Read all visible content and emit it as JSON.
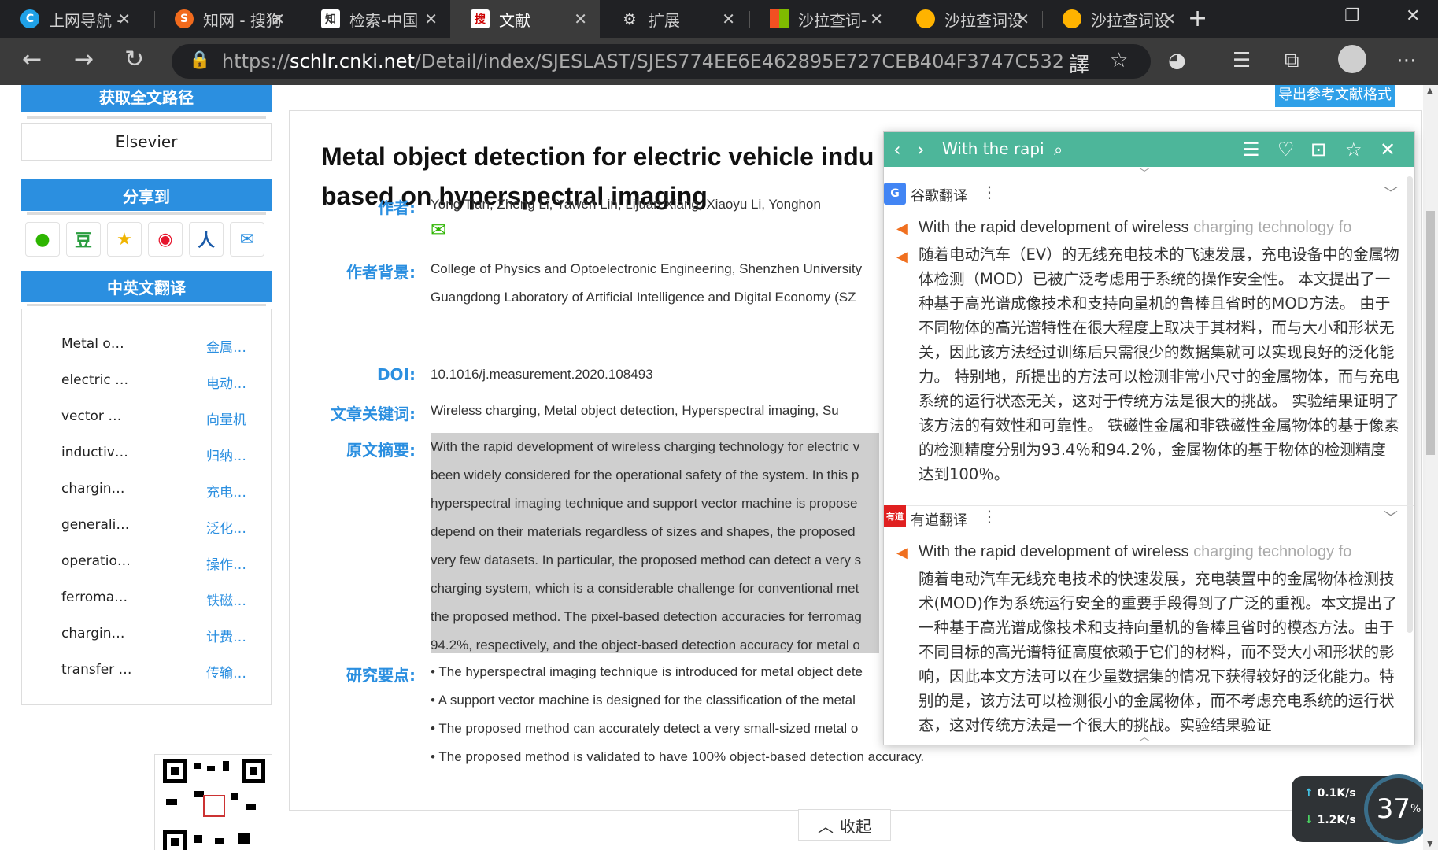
{
  "tabs": [
    {
      "title": "上网导航 - ",
      "icon": "edge-c-icon",
      "color": "#1fa1e8"
    },
    {
      "title": "知网 - 搜狗",
      "icon": "sogou-icon",
      "color": "#f26b1d"
    },
    {
      "title": "检索-中国",
      "icon": "cnki-icon",
      "color": "#555555"
    },
    {
      "title": "文献",
      "icon": "sou-icon",
      "color": "#ffffff"
    },
    {
      "title": "扩展",
      "icon": "extension-icon",
      "color": "#cccccc"
    },
    {
      "title": "沙拉查词-",
      "icon": "microsoft-icon",
      "color": "#f25022"
    },
    {
      "title": "沙拉查词设",
      "icon": "saladict-icon",
      "color": "#ffb300"
    },
    {
      "title": "沙拉查词设",
      "icon": "saladict-icon",
      "color": "#ffb300"
    }
  ],
  "url": {
    "prefix": "https://",
    "host": "schlr.cnki.net",
    "path": "/Detail/index/SJESLAST/SJES774EE6E462895E727CEB404F3747C532"
  },
  "sidebar": {
    "fulltext_head": "获取全文路径",
    "publisher": "Elsevier",
    "share_head": "分享到",
    "share_icons": [
      "wechat-icon",
      "douban-icon",
      "favorite-icon",
      "weibo-icon",
      "renren-icon",
      "mail-icon"
    ],
    "share_glyphs": [
      "●",
      "豆",
      "★",
      "◉",
      "人",
      "✉"
    ],
    "translate_head": "中英文翻译",
    "translations": [
      {
        "en": "Metal o…",
        "zh": "金属…"
      },
      {
        "en": "electric …",
        "zh": "电动…"
      },
      {
        "en": "vector …",
        "zh": "向量机"
      },
      {
        "en": "inductiv…",
        "zh": "归纳…"
      },
      {
        "en": "chargin…",
        "zh": "充电…"
      },
      {
        "en": "generali…",
        "zh": "泛化…"
      },
      {
        "en": "operatio…",
        "zh": "操作…"
      },
      {
        "en": "ferroma…",
        "zh": "铁磁…"
      },
      {
        "en": "chargin…",
        "zh": "计费…"
      },
      {
        "en": "transfer …",
        "zh": "传输…"
      }
    ]
  },
  "article": {
    "export_label": "导出参考文献格式",
    "title_line1": "Metal object detection for electric vehicle indu",
    "title_line2": "based on hyperspectral imaging",
    "labels": {
      "authors": "作者:",
      "affiliation": "作者背景:",
      "doi": "DOI:",
      "keywords": "文章关键词:",
      "abstract": "原文摘要:",
      "highlights": "研究要点:"
    },
    "authors": "Yong Tian,   Zheng Li,   Yawen Lin,   Lijuan Xiang,   Xiaoyu Li,   Yonghon",
    "affiliation_line1": "College of Physics and Optoelectronic Engineering, Shenzhen University",
    "affiliation_line2": "Guangdong Laboratory of Artificial Intelligence and Digital Economy (SZ",
    "doi": "10.1016/j.measurement.2020.108493",
    "keywords": "Wireless charging,   Metal object detection,   Hyperspectral imaging,   Su",
    "abstract_lines": [
      "With the rapid development of wireless charging technology for electric v",
      "been widely considered for the operational safety of the system. In this p",
      "hyperspectral imaging technique and support vector machine is propose",
      "depend on their materials regardless of sizes and shapes, the proposed",
      "very few datasets. In particular, the proposed method can detect a very s",
      "charging system, which is a considerable challenge for conventional met",
      "the proposed method. The pixel-based detection accuracies for ferromag",
      "94.2%, respectively, and the object-based detection accuracy for metal o"
    ],
    "highlights": [
      "• The hyperspectral imaging technique is introduced for metal object dete",
      "• A support vector machine is designed for the classification of the metal",
      "• The proposed method can accurately detect a very small-sized metal o",
      "• The proposed method is validated to have 100% object-based detection accuracy."
    ],
    "collapse_label": "收起"
  },
  "popup": {
    "search_text": "With the rapid",
    "google": {
      "name": "谷歌翻译",
      "source": "With the rapid development of wireless ",
      "source_fade": "charging technology fo",
      "result": "随着电动汽车（EV）的无线充电技术的飞速发展，充电设备中的金属物体检测（MOD）已被广泛考虑用于系统的操作安全性。 本文提出了一种基于高光谱成像技术和支持向量机的鲁棒且省时的MOD方法。 由于不同物体的高光谱特性在很大程度上取决于其材料，而与大小和形状无关，因此该方法经过训练后只需很少的数据集就可以实现良好的泛化能力。 特别地，所提出的方法可以检测非常小尺寸的金属物体，而与充电系统的运行状态无关，这对于传统方法是很大的挑战。 实验结果证明了该方法的有效性和可靠性。 铁磁性金属和非铁磁性金属物体的基于像素的检测精度分别为93.4％和94.2％，金属物体的基于物体的检测精度达到100％。"
    },
    "youdao": {
      "name": "有道翻译",
      "logo_text": "有道",
      "source": "With the rapid development of wireless ",
      "source_fade": "charging technology fo",
      "result": "随着电动汽车无线充电技术的快速发展，充电装置中的金属物体检测技术(MOD)作为系统运行安全的重要手段得到了广泛的重视。本文提出了一种基于高光谱成像技术和支持向量机的鲁棒且省时的模态方法。由于不同目标的高光谱特征高度依赖于它们的材料，而不受大小和形状的影响，因此本文方法可以在少量数据集的情况下获得较好的泛化能力。特别的是，该方法可以检测很小的金属物体，而不考虑充电系统的运行状态，这对传统方法是一个很大的挑战。实验结果验证"
    }
  },
  "netspeed": {
    "up": "0.1K/s",
    "down": "1.2K/s",
    "percent": "37",
    "percent_unit": "%"
  }
}
